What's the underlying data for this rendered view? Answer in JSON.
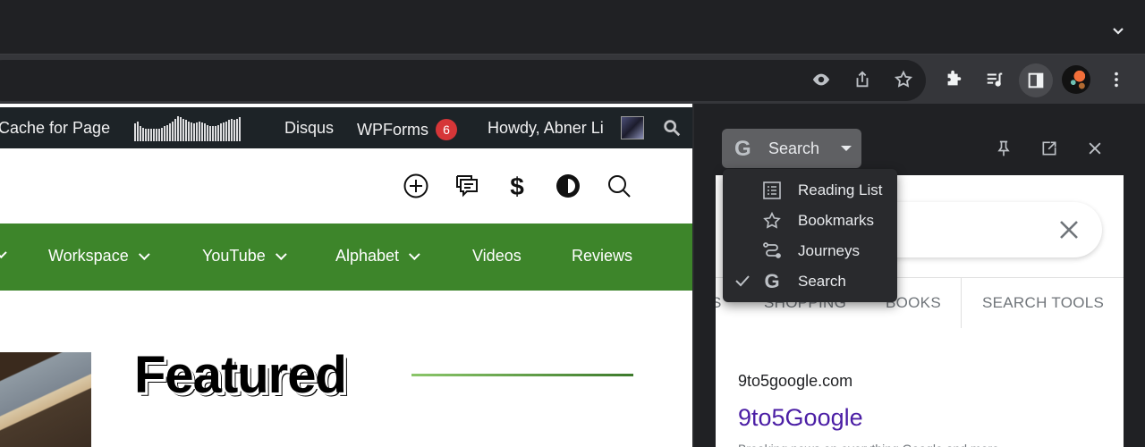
{
  "browser": {
    "toolbar_icons": [
      "eye-icon",
      "share-icon",
      "bookmark-star-icon",
      "extensions-icon",
      "media-queue-icon",
      "side-panel-icon",
      "profile-avatar",
      "more-menu-icon"
    ]
  },
  "admin_bar": {
    "cache_label": "Cache for Page",
    "disqus_label": "Disqus",
    "wpforms_label": "WPForms",
    "wpforms_count": "6",
    "howdy_label": "Howdy, Abner Li",
    "waveform_levels": [
      0.7,
      0.8,
      0.6,
      0.55,
      0.5,
      0.5,
      0.5,
      0.5,
      0.5,
      0.5,
      0.55,
      0.6,
      0.65,
      0.7,
      0.8,
      0.9,
      1.0,
      0.95,
      0.9,
      0.85,
      0.8,
      0.75,
      0.7,
      0.75,
      0.8,
      0.75,
      0.7,
      0.65,
      0.6,
      0.6,
      0.6,
      0.65,
      0.7,
      0.75,
      0.8,
      0.85,
      0.9,
      0.85,
      0.9,
      0.95
    ]
  },
  "site_header": {
    "icons": [
      "add-circle-icon",
      "comments-icon",
      "dollar-icon",
      "contrast-icon",
      "search-icon"
    ]
  },
  "nav": {
    "items": [
      {
        "label": "Workspace",
        "has_dropdown": true
      },
      {
        "label": "YouTube",
        "has_dropdown": true
      },
      {
        "label": "Alphabet",
        "has_dropdown": true
      },
      {
        "label": "Videos",
        "has_dropdown": false
      },
      {
        "label": "Reviews",
        "has_dropdown": false
      }
    ]
  },
  "featured": {
    "title": "Featured"
  },
  "side_panel": {
    "selector_label": "Search",
    "menu": [
      {
        "label": "Reading List",
        "icon": "reading-list-icon",
        "checked": false
      },
      {
        "label": "Bookmarks",
        "icon": "bookmarks-star-icon",
        "checked": false
      },
      {
        "label": "Journeys",
        "icon": "journeys-icon",
        "checked": false
      },
      {
        "label": "Search",
        "icon": "google-g-icon",
        "checked": true
      }
    ],
    "tabs": [
      "S",
      "SHOPPING",
      "BOOKS",
      "SEARCH TOOLS"
    ],
    "result": {
      "domain": "9to5google.com",
      "title": "9to5Google",
      "snippet": "Breaking news on everything Google and more..."
    },
    "colors": {
      "link": "#4b1ea5"
    }
  },
  "colors": {
    "nav_green": "#3d852a",
    "admin_bar": "#1d2327",
    "badge_red": "#d63638"
  }
}
